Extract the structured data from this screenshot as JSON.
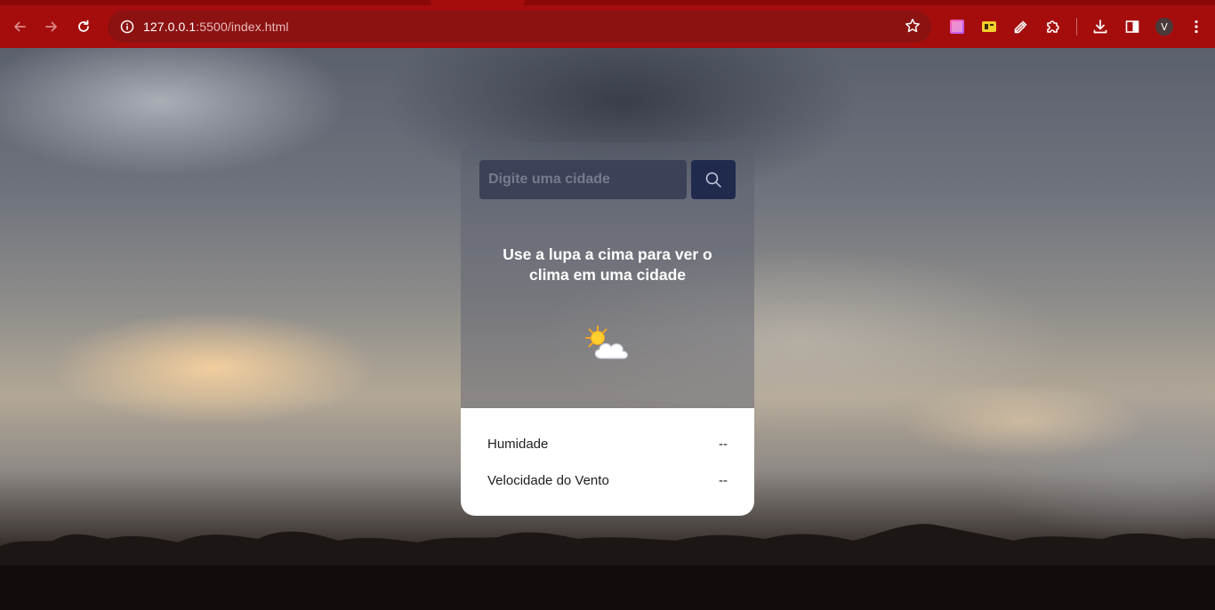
{
  "browser": {
    "url_host": "127.0.0.1",
    "url_rest": ":5500/index.html",
    "avatar_letter": "V",
    "icons": {
      "back": "arrow-left-icon",
      "forward": "arrow-right-icon",
      "reload": "reload-icon",
      "info": "info-icon",
      "bookmark": "star-icon",
      "extensions": [
        "color-picker-extension-icon",
        "yellow-extension-icon",
        "eyedropper-icon",
        "puzzle-icon"
      ],
      "download": "download-icon",
      "sidepanel": "side-panel-icon",
      "menu": "kebab-menu-icon"
    },
    "colors": {
      "frame": "#a50d0d",
      "omnibox": "#8c1212"
    }
  },
  "weather": {
    "search": {
      "placeholder": "Digite uma cidade",
      "value": ""
    },
    "message": "Use a lupa a cima para ver o clima em uma cidade",
    "icon": "partly-cloudy-icon",
    "details": [
      {
        "label": "Humidade",
        "value": "--"
      },
      {
        "label": "Velocidade do Vento",
        "value": "--"
      }
    ],
    "colors": {
      "button": "#1f2a4d",
      "input": "#3c4157"
    }
  }
}
